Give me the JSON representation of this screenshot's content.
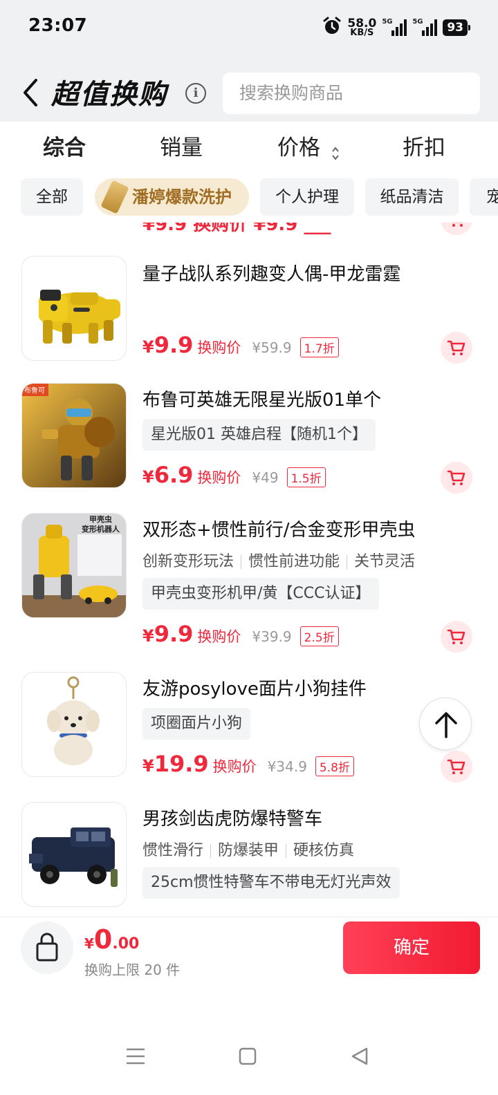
{
  "status_bar": {
    "time": "23:07",
    "net_speed": "58.0",
    "net_unit": "KB/S",
    "signal1_label": "5G",
    "signal2_label": "5G",
    "battery": "93",
    "icons": [
      "alarm-icon",
      "signal-icon",
      "battery-icon"
    ]
  },
  "header": {
    "title": "超值换购",
    "search_placeholder": "搜索换购商品",
    "icons": [
      "back-icon",
      "info-icon"
    ]
  },
  "sort_tabs": [
    {
      "label": "综合",
      "active": true
    },
    {
      "label": "销量",
      "active": false
    },
    {
      "label": "价格",
      "active": false
    },
    {
      "label": "折扣",
      "active": false
    }
  ],
  "categories": [
    {
      "label": "全部"
    },
    {
      "label": "潘婷爆款洗护"
    },
    {
      "label": "个人护理"
    },
    {
      "label": "纸品清洁"
    },
    {
      "label": "宠"
    }
  ],
  "partial_price": "¥9.9 换购价 ¥9.9 ___",
  "items": [
    {
      "title": "量子战队系列趣变人偶-甲龙雷霆",
      "currency": "¥",
      "price": "9.9",
      "price_label": "换购价",
      "original_price": "¥59.9",
      "discount": "1.7折",
      "image": "yellow-robot-dinosaur"
    },
    {
      "title": "布鲁可英雄无限星光版01单个",
      "spec": "星光版01 英雄启程【随机1个】",
      "currency": "¥",
      "price": "6.9",
      "price_label": "换购价",
      "original_price": "¥49",
      "discount": "1.5折",
      "image": "gold-robot-figure"
    },
    {
      "title": "双形态+惯性前行/合金变形甲壳虫",
      "features": [
        "创新变形玩法",
        "惯性前进功能",
        "关节灵活"
      ],
      "spec": "甲壳虫变形机甲/黄【CCC认证】",
      "currency": "¥",
      "price": "9.9",
      "price_label": "换购价",
      "original_price": "¥39.9",
      "discount": "2.5折",
      "image": "beetle-transformer",
      "image_text": [
        "甲壳虫",
        "变形机器人"
      ]
    },
    {
      "title": "友游posylove面片小狗挂件",
      "spec": "项圈面片小狗",
      "currency": "¥",
      "price": "19.9",
      "price_label": "换购价",
      "original_price": "¥34.9",
      "discount": "5.8折",
      "image": "plush-dog-keychain"
    },
    {
      "title": "男孩剑齿虎防爆特警车",
      "features": [
        "惯性滑行",
        "防爆装甲",
        "硬核仿真"
      ],
      "spec": "25cm惯性特警车不带电无灯光声效",
      "image": "swat-truck"
    }
  ],
  "bottom_bar": {
    "currency": "¥",
    "total_int": "0",
    "total_dec": ".00",
    "limit_text": "换购上限 20 件",
    "confirm_label": "确定"
  },
  "colors": {
    "accent": "#f0283c",
    "header_bg": "#f0f1f3",
    "chip_bg": "#f3f4f6",
    "brand_chip_bg": "#f6ead2"
  }
}
